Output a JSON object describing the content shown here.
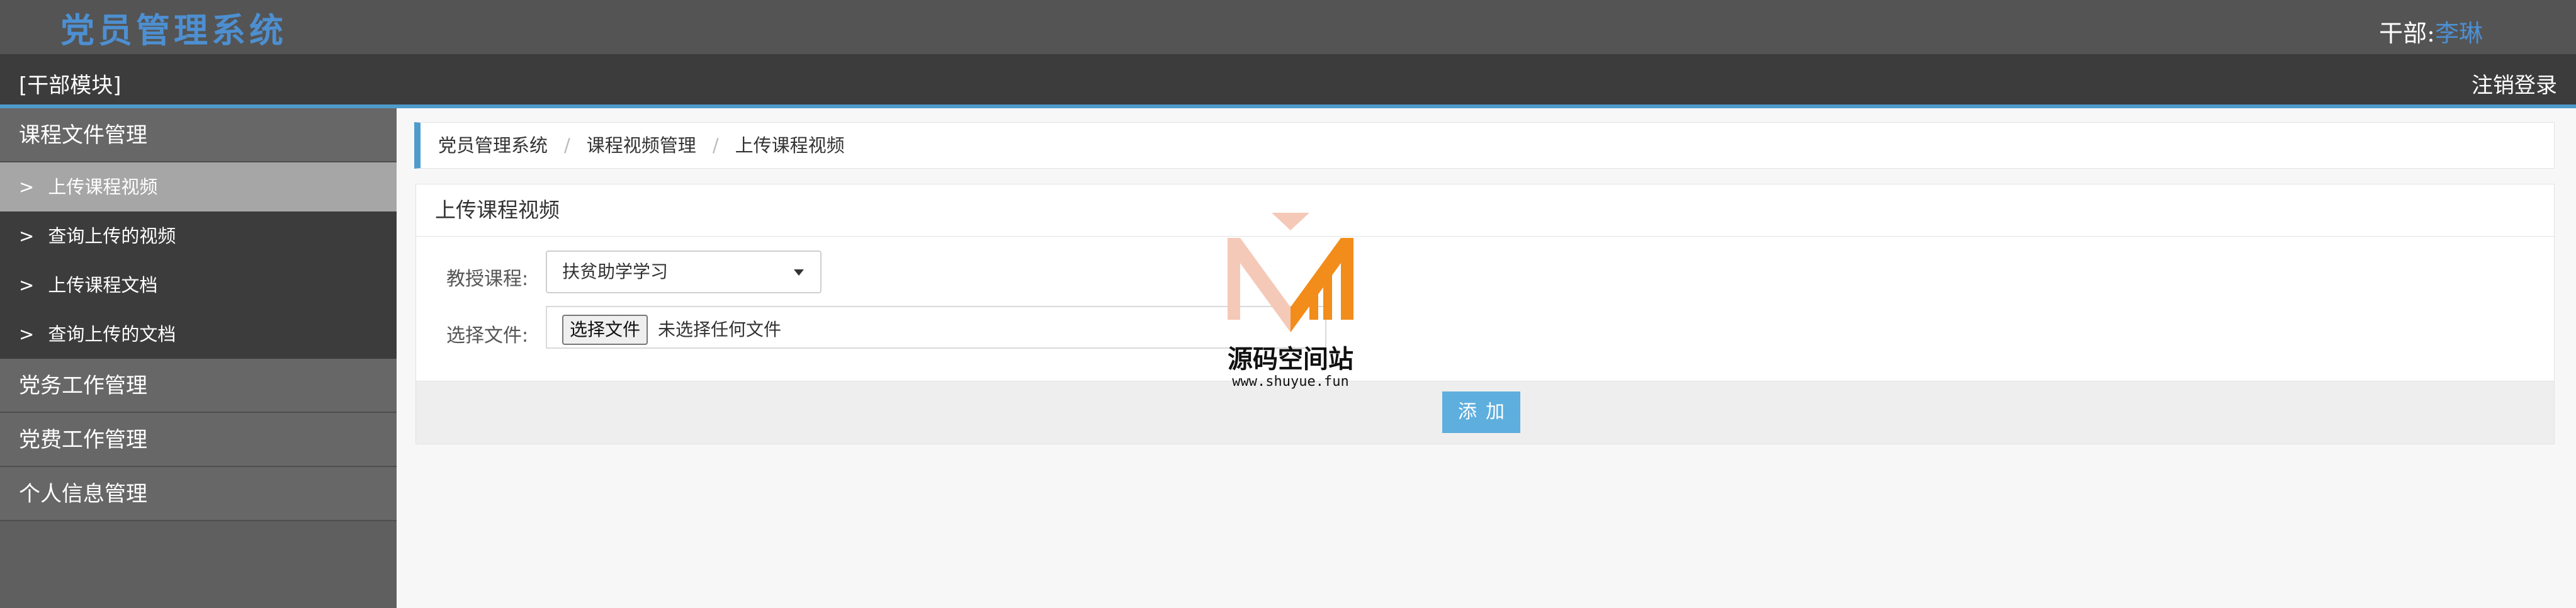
{
  "header": {
    "app_title": "党员管理系统",
    "user_role": "干部:",
    "user_name": "李琳"
  },
  "module_bar": {
    "module_label": "[干部模块]",
    "logout_label": "注销登录"
  },
  "sidebar": {
    "groups": [
      {
        "label": "课程文件管理",
        "items": [
          {
            "arrow": ">",
            "label": "上传课程视频"
          },
          {
            "arrow": ">",
            "label": "查询上传的视频"
          },
          {
            "arrow": ">",
            "label": "上传课程文档"
          },
          {
            "arrow": ">",
            "label": "查询上传的文档"
          }
        ]
      },
      {
        "label": "党务工作管理"
      },
      {
        "label": "党费工作管理"
      },
      {
        "label": "个人信息管理"
      }
    ]
  },
  "breadcrumb": {
    "items": [
      "党员管理系统",
      "课程视频管理",
      "上传课程视频"
    ],
    "separator": "/"
  },
  "form": {
    "title": "上传课程视频",
    "course_label": "教授课程:",
    "course_value": "扶贫助学学习",
    "file_label": "选择文件:",
    "file_button": "选择文件",
    "file_status": "未选择任何文件",
    "submit_label": "添加"
  },
  "watermark": {
    "name": "源码空间站",
    "url": "www.shuyue.fun"
  },
  "colors": {
    "accent": "#4f9ccc",
    "title_blue": "#4d8fd1",
    "button_blue": "#5eaede",
    "logo_orange": "#f28c1b",
    "logo_pink": "#f4c9b8"
  }
}
